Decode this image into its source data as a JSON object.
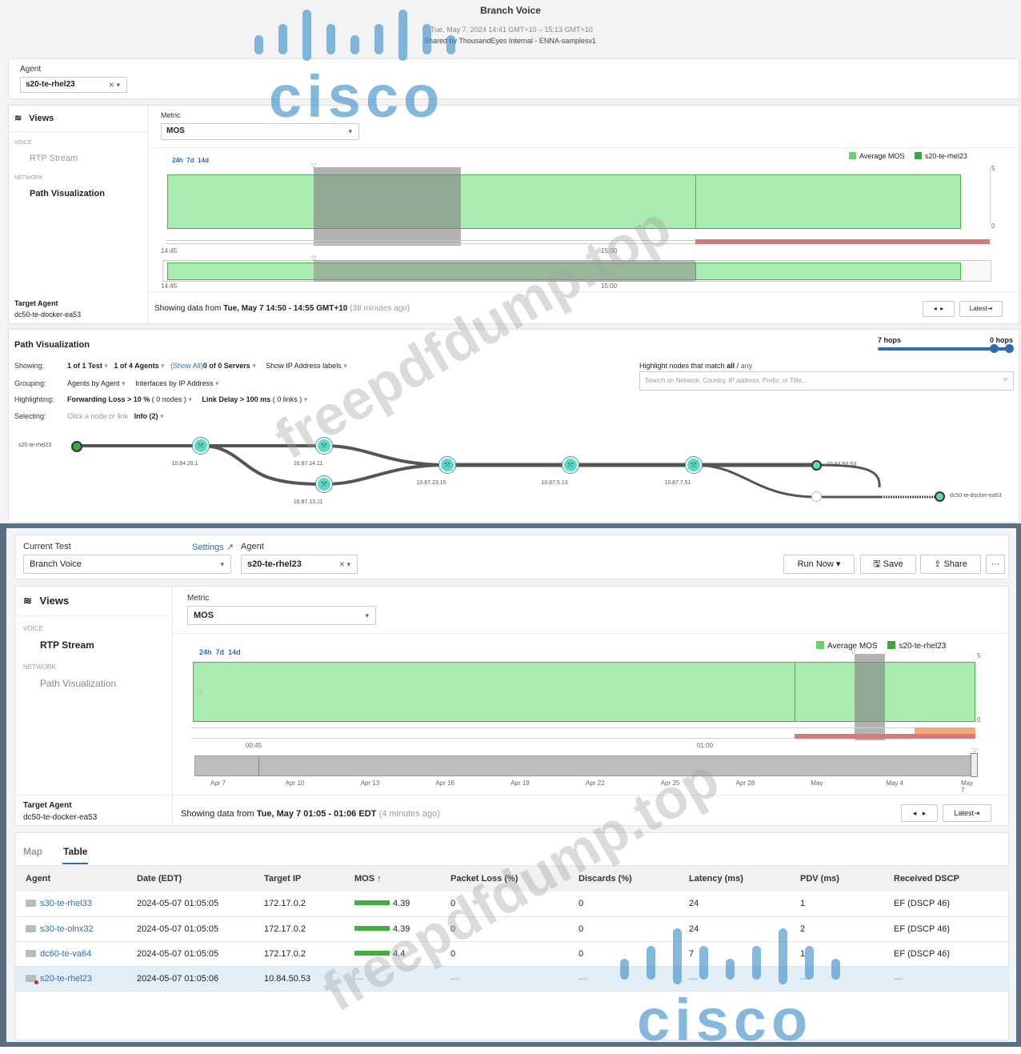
{
  "top": {
    "title": "Branch Voice",
    "subtitle_time": "Tue, May 7, 2024 14:41 GMT+10 – 15:13 GMT+10",
    "shared_by": "Shared by ThousandEyes Internal - ENNA-samplesv1",
    "agent_label": "Agent",
    "agent_value": "s20-te-rhel23",
    "views_title": "Views",
    "views_section_voice": "VOICE",
    "views_rtp": "RTP Stream",
    "views_section_network": "NETWORK",
    "views_path": "Path Visualization",
    "target_agent_label": "Target Agent",
    "target_agent_value": "dc50-te-docker-ea53",
    "metric_label": "Metric",
    "metric_value": "MOS",
    "ranges": [
      "24h",
      "7d",
      "14d"
    ],
    "legend": [
      "Average MOS",
      "s20-te-rhel23"
    ],
    "y_ticks": [
      "5",
      "0"
    ],
    "x_ticks_main": [
      "14:45",
      "15:00"
    ],
    "x_ticks_nav": [
      "14:45",
      "15:00"
    ],
    "showing_prefix": "Showing data from",
    "showing_range": "Tue, May 7 14:50 - 14:55 GMT+10",
    "showing_ago": "(38 minutes ago)",
    "latest": "Latest⇥",
    "path": {
      "title": "Path Visualization",
      "hops_left": "7 hops",
      "hops_right": "0 hops",
      "showing_label": "Showing:",
      "showing_test": "1 of 1 Test",
      "showing_agents": "1 of 4 Agents",
      "show_all": "(Show All)",
      "servers": "0 of 0 Servers",
      "show_ip": "Show IP Address labels",
      "grouping_label": "Grouping:",
      "grouping_1": "Agents by Agent",
      "grouping_2": "Interfaces by IP Address",
      "highlighting_label": "Highlighting:",
      "highlight_1": "Forwarding Loss > 10 %",
      "highlight_1_count": "( 0 nodes )",
      "highlight_2": "Link Delay > 100 ms",
      "highlight_2_count": "( 0 links )",
      "selecting_label": "Selecting:",
      "selecting_hint": "Click a node or link",
      "selecting_info": "Info (2)",
      "highlight_match": "Highlight nodes that match",
      "all": "all",
      "slash": "/",
      "any": "any",
      "search_placeholder": "Search on Network, Country, IP address, Prefix, or Title...",
      "nodes": {
        "source": "s20-te-rhel23",
        "n1": "10.84.20.1",
        "n2": "10.87.14.11",
        "n3": "10.87.13.11",
        "n4": "10.87.23.15",
        "n5": "10.87.5.13",
        "n6": "10.87.7.51",
        "n7": "10.84.50.53",
        "dest": "dc50-te-docker-ea53"
      }
    }
  },
  "bottom": {
    "current_test_label": "Current Test",
    "current_test_value": "Branch Voice",
    "settings": "Settings",
    "agent_label": "Agent",
    "agent_value": "s20-te-rhel23",
    "run_now": "Run Now",
    "save": "Save",
    "share": "Share",
    "more": "···",
    "views_title": "Views",
    "views_section_voice": "VOICE",
    "views_rtp": "RTP Stream",
    "views_section_network": "NETWORK",
    "views_path": "Path Visualization",
    "target_agent_label": "Target Agent",
    "target_agent_value": "dc50-te-docker-ea53",
    "metric_label": "Metric",
    "metric_value": "MOS",
    "ranges": [
      "24h",
      "7d",
      "14d"
    ],
    "legend": [
      "Average MOS",
      "s20-te-rhel23"
    ],
    "y_ticks": [
      "5",
      "0"
    ],
    "x_ticks_main": [
      "00:45",
      "01:00"
    ],
    "nav_ticks": [
      "Apr 7",
      "Apr 10",
      "Apr 13",
      "Apr 16",
      "Apr 19",
      "Apr 22",
      "Apr 25",
      "Apr 28",
      "May",
      "May 4",
      "May 7"
    ],
    "showing_prefix": "Showing data from",
    "showing_range": "Tue, May 7 01:05 - 01:06 EDT",
    "showing_ago": "(4 minutes ago)",
    "latest": "Latest⇥",
    "tabs": [
      "Map",
      "Table"
    ],
    "table": {
      "headers": [
        "Agent",
        "Date (EDT)",
        "Target IP",
        "MOS",
        "Packet Loss (%)",
        "Discards (%)",
        "Latency (ms)",
        "PDV (ms)",
        "Received DSCP"
      ],
      "rows": [
        {
          "agent": "s30-te-rhel33",
          "date": "2024-05-07 01:05:05",
          "ip": "172.17.0.2",
          "mos": "4.39",
          "loss": "0",
          "discards": "0",
          "latency": "24",
          "pdv": "1",
          "dscp": "EF (DSCP 46)"
        },
        {
          "agent": "s30-te-olnx32",
          "date": "2024-05-07 01:05:05",
          "ip": "172.17.0.2",
          "mos": "4.39",
          "loss": "0",
          "discards": "0",
          "latency": "24",
          "pdv": "2",
          "dscp": "EF (DSCP 46)"
        },
        {
          "agent": "dc60-te-va64",
          "date": "2024-05-07 01:05:05",
          "ip": "172.17.0.2",
          "mos": "4.4",
          "loss": "0",
          "discards": "0",
          "latency": "7",
          "pdv": "1",
          "dscp": "EF (DSCP 46)"
        },
        {
          "agent": "s20-te-rhel23",
          "date": "2024-05-07 01:05:06",
          "ip": "10.84.50.53",
          "mos": "—",
          "loss": "—",
          "discards": "—",
          "latency": "—",
          "pdv": "—",
          "dscp": "—"
        }
      ]
    }
  },
  "overlay": {
    "watermark": "freepdfdump.top",
    "cisco_logo": "cisco"
  },
  "colors": {
    "green_fill": "#aaebb0",
    "green_line": "#46b04d",
    "legend_avg": "#6ccf6c",
    "legend_agent": "#3aa83a",
    "loss_red": "#d47a7a",
    "node_teal": "#5ed7c5",
    "link_blue": "#2d6db4",
    "hops_slider": "#2d6db4"
  }
}
